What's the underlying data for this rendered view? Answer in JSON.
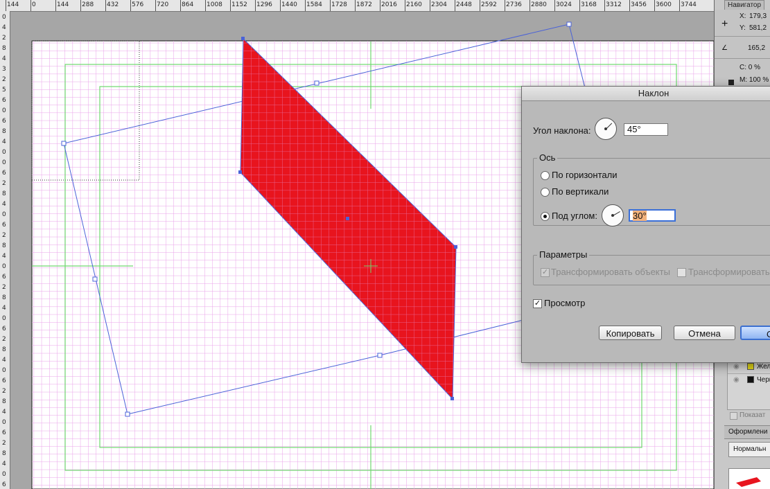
{
  "rulers": {
    "top_labels": [
      "144",
      "0",
      "144",
      "288",
      "432",
      "576",
      "720",
      "864",
      "1008",
      "1152",
      "1296",
      "1440",
      "1584",
      "1728",
      "1872",
      "2016",
      "2160",
      "2304",
      "2448",
      "2592",
      "2736",
      "2880",
      "3024",
      "3168",
      "3312",
      "3456",
      "3600",
      "3744"
    ],
    "left_labels": [
      "0",
      "4",
      "2",
      "8",
      "4",
      "3",
      "2",
      "5",
      "6",
      "0",
      "6",
      "8",
      "4",
      "0",
      "0",
      "6",
      "2",
      "8",
      "4",
      "0",
      "6",
      "2",
      "8",
      "4",
      "0",
      "6",
      "2",
      "8",
      "4",
      "0",
      "6",
      "2",
      "8",
      "4",
      "0",
      "6",
      "2",
      "8",
      "4",
      "0",
      "6",
      "2",
      "8",
      "4",
      "0",
      "6"
    ]
  },
  "right_panel": {
    "navigator_tab": "Навигатор",
    "x_label": "X:",
    "x_value": "179,3",
    "y_label": "Y:",
    "y_value": "581,2",
    "angle_value": "165,2",
    "c_value": "C: 0 %",
    "m_value": "M: 100 %",
    "layer1": "Жел",
    "layer2": "Черн",
    "show_label": "Показат",
    "appearance_tab": "Оформлени",
    "normal_option": "Нормальн"
  },
  "dialog": {
    "title": "Наклон",
    "shear_angle_label": "Угол наклона:",
    "shear_angle_value": "45°",
    "axis_group": "Ось",
    "horizontal_label": "По горизонтали",
    "vertical_label": "По вертикали",
    "angle_label": "Под углом:",
    "angle_value": "30°",
    "options_group": "Параметры",
    "transform_objects_label": "Трансформировать объекты",
    "transform_patterns_label": "Трансформировать",
    "preview_label": "Просмотр",
    "copy_button": "Копировать",
    "cancel_button": "Отмена",
    "ok_button": "OK"
  },
  "colors": {
    "shape_fill": "#e8141e",
    "grid_line": "#e36fe3",
    "guide_green": "#6fd86f",
    "selection_blue": "#4a62d8"
  }
}
